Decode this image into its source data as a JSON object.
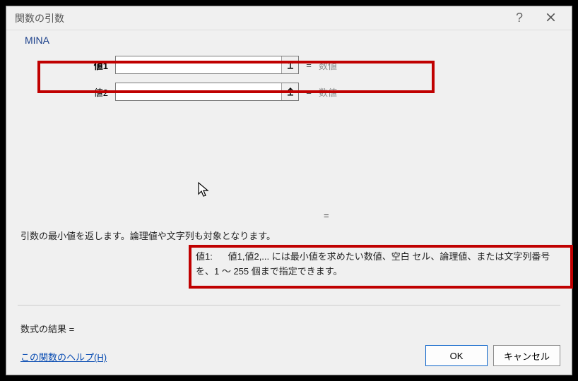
{
  "dialog": {
    "title": "関数の引数",
    "help_tooltip": "?",
    "close_tooltip": "×"
  },
  "function": {
    "name": "MINA"
  },
  "args": [
    {
      "label": "値1",
      "value": "",
      "hint": "数値",
      "bold": true
    },
    {
      "label": "値2",
      "value": "",
      "hint": "数値",
      "bold": false
    }
  ],
  "equals_mid": "=",
  "description": "引数の最小値を返します。論理値や文字列も対象となります。",
  "arg_help": {
    "name": "値1:",
    "text": "値1,値2,... には最小値を求めたい数値、空白 セル、論理値、または文字列番号を、1 ～ 255 個まで指定できます。"
  },
  "result_label": "数式の結果 =",
  "help_link": "この関数のヘルプ(H)",
  "buttons": {
    "ok": "OK",
    "cancel": "キャンセル"
  },
  "row_eq": "="
}
